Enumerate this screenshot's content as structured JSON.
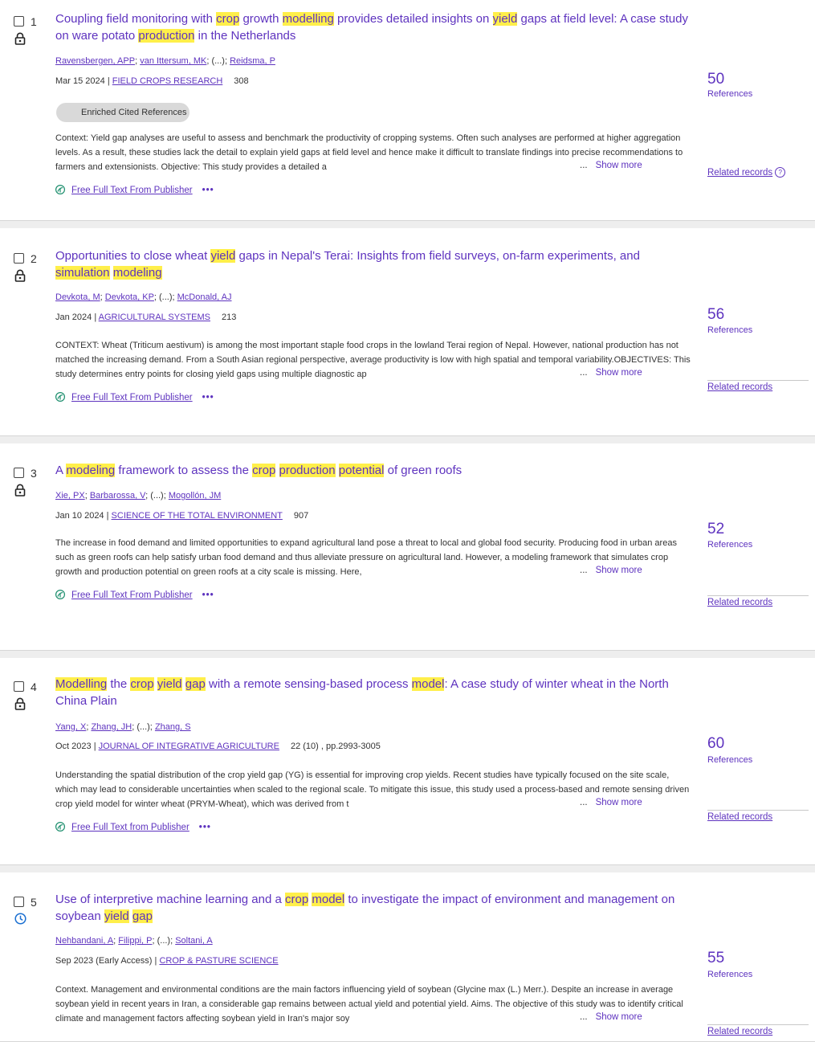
{
  "ui": {
    "show_more": "Show more",
    "ellipsis": "...",
    "references_label": "References",
    "related_label": "Related records",
    "more_dots": "•••",
    "enriched_label": "Enriched Cited References",
    "help_glyph": "?"
  },
  "records": [
    {
      "index": "1",
      "icon": "lock-icon",
      "title_segments": [
        {
          "t": "Coupling field monitoring with ",
          "h": false
        },
        {
          "t": "crop",
          "h": true
        },
        {
          "t": " growth ",
          "h": false
        },
        {
          "t": "modelling",
          "h": true
        },
        {
          "t": " provides detailed insights on ",
          "h": false
        },
        {
          "t": "yield",
          "h": true
        },
        {
          "t": " gaps at field level: A case study on ware potato ",
          "h": false
        },
        {
          "t": "production",
          "h": true
        },
        {
          "t": " in the Netherlands",
          "h": false
        }
      ],
      "authors": [
        "Ravensbergen, APP",
        "van Ittersum, MK",
        "Reidsma, P"
      ],
      "date": "Mar 15 2024",
      "journal": "FIELD CROPS RESEARCH",
      "volume": "308",
      "enriched": true,
      "abstract": "Context: Yield gap analyses are useful to assess and benchmark the productivity of cropping systems. Often such analyses are performed at higher aggregation levels. As a result, these studies lack the detail to explain yield gaps at field level and hence make it difficult to translate findings into precise recommendations to farmers and extensionists. Objective: This study provides a detailed a",
      "fulltext": "Free Full Text From Publisher",
      "references": "50",
      "related_help": true
    },
    {
      "index": "2",
      "icon": "lock-icon",
      "title_segments": [
        {
          "t": "Opportunities to close wheat ",
          "h": false
        },
        {
          "t": "yield",
          "h": true
        },
        {
          "t": " gaps in Nepal's Terai: Insights from field surveys, on-farm experiments, and ",
          "h": false
        },
        {
          "t": "simulation",
          "h": true
        },
        {
          "t": " ",
          "h": false
        },
        {
          "t": "modeling",
          "h": true
        }
      ],
      "authors": [
        "Devkota, M",
        "Devkota, KP",
        "McDonald, AJ"
      ],
      "date": "Jan 2024",
      "journal": "AGRICULTURAL SYSTEMS",
      "volume": "213",
      "enriched": false,
      "abstract": "CONTEXT: Wheat (Triticum aestivum) is among the most important staple food crops in the lowland Terai region of Nepal. However, national production has not matched the increasing demand. From a South Asian regional perspective, average productivity is low with high spatial and temporal variability.OBJECTIVES: This study determines entry points for closing yield gaps using multiple diagnostic ap",
      "fulltext": "Free Full Text From Publisher",
      "references": "56",
      "related_help": false
    },
    {
      "index": "3",
      "icon": "lock-icon",
      "title_segments": [
        {
          "t": "A ",
          "h": false
        },
        {
          "t": "modeling",
          "h": true
        },
        {
          "t": " framework to assess the ",
          "h": false
        },
        {
          "t": "crop",
          "h": true
        },
        {
          "t": " ",
          "h": false
        },
        {
          "t": "production",
          "h": true
        },
        {
          "t": " ",
          "h": false
        },
        {
          "t": "potential",
          "h": true
        },
        {
          "t": " of green roofs",
          "h": false
        }
      ],
      "authors": [
        "Xie, PX",
        "Barbarossa, V",
        "Mogollón, JM"
      ],
      "date": "Jan 10 2024",
      "journal": "SCIENCE OF THE TOTAL ENVIRONMENT",
      "volume": "907",
      "enriched": false,
      "abstract": "The increase in food demand and limited opportunities to expand agricultural land pose a threat to local and global food security. Producing food in urban areas such as green roofs can help satisfy urban food demand and thus alleviate pressure on agricultural land. However, a modeling framework that simulates crop growth and production potential on green roofs at a city scale is missing. Here,",
      "fulltext": "Free Full Text From Publisher",
      "references": "52",
      "related_help": false
    },
    {
      "index": "4",
      "icon": "lock-icon",
      "title_segments": [
        {
          "t": "Modelling",
          "h": true
        },
        {
          "t": " the ",
          "h": false
        },
        {
          "t": "crop",
          "h": true
        },
        {
          "t": " ",
          "h": false
        },
        {
          "t": "yield",
          "h": true
        },
        {
          "t": " ",
          "h": false
        },
        {
          "t": "gap",
          "h": true
        },
        {
          "t": " with a remote sensing-based process ",
          "h": false
        },
        {
          "t": "model",
          "h": true
        },
        {
          "t": ": A case study of winter wheat in the North China Plain",
          "h": false
        }
      ],
      "authors": [
        "Yang, X",
        "Zhang, JH",
        "Zhang, S"
      ],
      "date": "Oct 2023",
      "journal": "JOURNAL OF INTEGRATIVE AGRICULTURE",
      "volume": "22 (10) , pp.2993-3005",
      "enriched": false,
      "abstract": "Understanding the spatial distribution of the crop yield gap (YG) is essential for improving crop yields. Recent studies have typically focused on the site scale, which may lead to considerable uncertainties when scaled to the regional scale. To mitigate this issue, this study used a process-based and remote sensing driven crop yield model for winter wheat (PRYM-Wheat), which was derived from t",
      "fulltext": "Free Full Text from Publisher",
      "references": "60",
      "related_help": false
    },
    {
      "index": "5",
      "icon": "clock-icon",
      "title_segments": [
        {
          "t": "Use of interpretive machine learning and a ",
          "h": false
        },
        {
          "t": "crop",
          "h": true
        },
        {
          "t": " ",
          "h": false
        },
        {
          "t": "model",
          "h": true
        },
        {
          "t": " to investigate the impact of environment and management on soybean ",
          "h": false
        },
        {
          "t": "yield",
          "h": true
        },
        {
          "t": " ",
          "h": false
        },
        {
          "t": "gap",
          "h": true
        }
      ],
      "authors": [
        "Nehbandani, A",
        "Filippi, P",
        "Soltani, A"
      ],
      "date": "Sep 2023 (Early Access)",
      "journal": "CROP & PASTURE SCIENCE",
      "volume": "",
      "enriched": false,
      "abstract": "Context. Management and environmental conditions are the main factors influencing yield of soybean (Glycine max (L.) Merr.). Despite an increase in average soybean yield in recent years in Iran, a considerable gap remains between actual yield and potential yield. Aims. The objective of this study was to identify critical climate and management factors affecting soybean yield in Iran's major soy",
      "fulltext": "",
      "references": "55",
      "related_help": false
    }
  ]
}
